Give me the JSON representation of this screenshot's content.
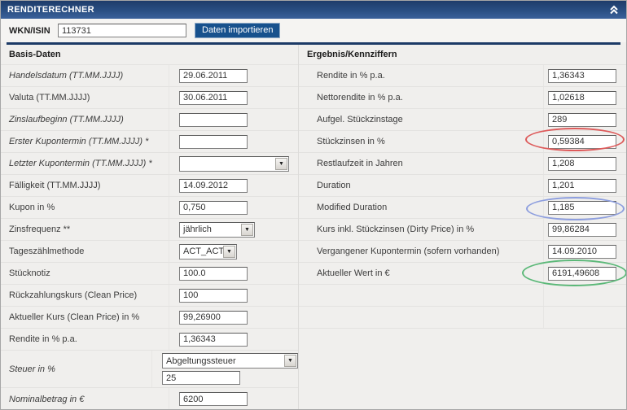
{
  "header": {
    "title": "RENDITERECHNER",
    "collapse_icon": "chevron-double-up"
  },
  "wkn": {
    "label": "WKN/ISIN",
    "value": "113731",
    "import_button": "Daten importieren"
  },
  "basis": {
    "title": "Basis-Daten",
    "rows": [
      {
        "label": "Handelsdatum (TT.MM.JJJJ)",
        "value": "29.06.2011"
      },
      {
        "label": "Valuta (TT.MM.JJJJ)",
        "value": "30.06.2011"
      },
      {
        "label": "Zinslaufbeginn (TT.MM.JJJJ)",
        "value": ""
      },
      {
        "label": "Erster Kupontermin (TT.MM.JJJJ) *",
        "value": ""
      },
      {
        "label": "Letzter Kupontermin (TT.MM.JJJJ) *",
        "value": ""
      },
      {
        "label": "Fälligkeit (TT.MM.JJJJ)",
        "value": "14.09.2012"
      },
      {
        "label": "Kupon in %",
        "value": "0,750"
      },
      {
        "label": "Zinsfrequenz **",
        "value": "jährlich"
      },
      {
        "label": "Tageszählmethode",
        "value": "ACT_ACT"
      },
      {
        "label": "Stücknotiz",
        "value": "100.0"
      },
      {
        "label": "Rückzahlungskurs (Clean Price)",
        "value": "100"
      },
      {
        "label": "Aktueller Kurs (Clean Price) in %",
        "value": "99,26900"
      },
      {
        "label": "Rendite in % p.a.",
        "value": "1,36343"
      },
      {
        "label": "Steuer in %",
        "value": "Abgeltungssteuer",
        "value2": "25"
      },
      {
        "label": "Nominalbetrag in €",
        "value": "6200"
      }
    ]
  },
  "ergebnis": {
    "title": "Ergebnis/Kennziffern",
    "rows": [
      {
        "label": "Rendite in % p.a.",
        "value": "1,36343"
      },
      {
        "label": "Nettorendite in % p.a.",
        "value": "1,02618"
      },
      {
        "label": "Aufgel. Stückzinstage",
        "value": "289"
      },
      {
        "label": "Stückzinsen in %",
        "value": "0,59384"
      },
      {
        "label": "Restlaufzeit in Jahren",
        "value": "1,208"
      },
      {
        "label": "Duration",
        "value": "1,201"
      },
      {
        "label": "Modified Duration",
        "value": "1,185"
      },
      {
        "label": "Kurs inkl. Stückzinsen (Dirty Price) in %",
        "value": "99,86284"
      },
      {
        "label": "Vergangener Kupontermin (sofern vorhanden)",
        "value": "14.09.2010"
      },
      {
        "label": "Aktueller Wert in €",
        "value": "6191,49608"
      }
    ]
  },
  "annotations": [
    {
      "name": "red-ellipse",
      "color": "#dd5a5a",
      "target": "Stückzinsen in %"
    },
    {
      "name": "blue-ellipse",
      "color": "#8d9ede",
      "target": "Modified Duration"
    },
    {
      "name": "green-ellipse",
      "color": "#5bb878",
      "target": "Aktueller Wert in €"
    }
  ],
  "icons": {
    "collapse": "chevron-double-up",
    "select_arrow": "▼"
  }
}
